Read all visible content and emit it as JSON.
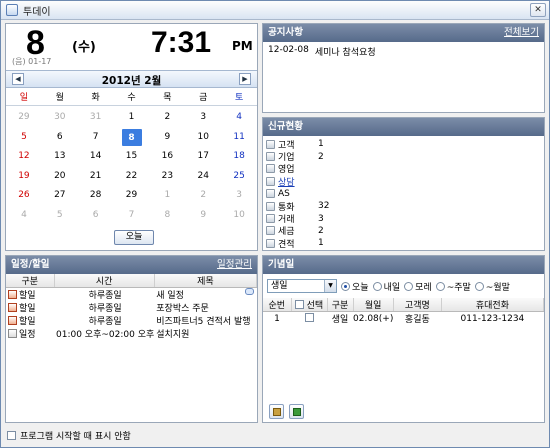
{
  "window": {
    "title": "투데이",
    "close": "✕"
  },
  "today": {
    "day": "8",
    "dow": "(수)",
    "lunar": "(음) 01-17",
    "time": "7:31",
    "ampm": "PM"
  },
  "calendar": {
    "month_label": "2012년 2월",
    "prev": "◀",
    "next": "▶",
    "weekdays": [
      "일",
      "월",
      "화",
      "수",
      "목",
      "금",
      "토"
    ],
    "weeks": [
      [
        "29",
        "30",
        "31",
        "1",
        "2",
        "3",
        "4"
      ],
      [
        "5",
        "6",
        "7",
        "8",
        "9",
        "10",
        "11"
      ],
      [
        "12",
        "13",
        "14",
        "15",
        "16",
        "17",
        "18"
      ],
      [
        "19",
        "20",
        "21",
        "22",
        "23",
        "24",
        "25"
      ],
      [
        "26",
        "27",
        "28",
        "29",
        "1",
        "2",
        "3"
      ],
      [
        "4",
        "5",
        "6",
        "7",
        "8",
        "9",
        "10"
      ]
    ],
    "selected": "8",
    "today_button": "오늘"
  },
  "notice": {
    "title": "공지사항",
    "view_all": "전체보기",
    "items": [
      {
        "date": "12-02-08",
        "text": "세미나 참석요청"
      }
    ]
  },
  "status": {
    "title": "신규현황",
    "items": [
      {
        "label": "고객",
        "value": "1"
      },
      {
        "label": "기업",
        "value": "2"
      },
      {
        "label": "영업",
        "value": ""
      },
      {
        "label": "상담",
        "value": ""
      },
      {
        "label": "AS",
        "value": ""
      },
      {
        "label": "통화",
        "value": "32"
      },
      {
        "label": "거래",
        "value": "3"
      },
      {
        "label": "세금",
        "value": "2"
      },
      {
        "label": "견적",
        "value": "1"
      }
    ]
  },
  "schedule": {
    "title": "일정/할일",
    "manage": "일정관리",
    "columns": [
      "구분",
      "시간",
      "제목"
    ],
    "rows": [
      {
        "type": "할일",
        "time": "하루종일",
        "title": "새 일정"
      },
      {
        "type": "할일",
        "time": "하루종일",
        "title": "포장박스 주문"
      },
      {
        "type": "할일",
        "time": "하루종일",
        "title": "비즈파트너5 견적서 발행"
      },
      {
        "type": "일정",
        "time": "01:00 오후~02:00 오후",
        "title": "설치지원"
      }
    ]
  },
  "anniversary": {
    "title": "기념일",
    "filter_value": "생일",
    "radios": [
      "오늘",
      "내일",
      "모레",
      "~주말",
      "~월말"
    ],
    "columns": [
      "순번",
      "선택",
      "구분",
      "월일",
      "고객명",
      "휴대전화"
    ],
    "rows": [
      {
        "no": "1",
        "type": "생일",
        "date": "02.08(+)",
        "name": "홍길동",
        "phone": "011-123-1234"
      }
    ]
  },
  "footer": {
    "startup_label": "프로그램 시작할 때 표시 안함"
  }
}
